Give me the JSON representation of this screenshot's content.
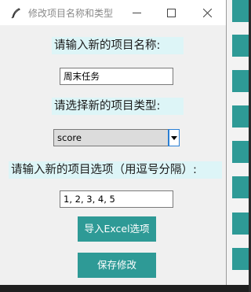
{
  "window": {
    "title": "修改项目名称和类型"
  },
  "form": {
    "name_label": "请输入新的项目名称:",
    "name_value": "周末任务",
    "type_label": "请选择新的项目类型:",
    "type_value": "score",
    "options_label": "请输入新的项目选项（用逗号分隔）:",
    "options_value": "1, 2, 3, 4, 5"
  },
  "buttons": {
    "import_label": "导入Excel选项",
    "save_label": "保存修改"
  },
  "icons": {
    "app": "feather-icon",
    "minimize": "minimize-icon",
    "maximize": "maximize-icon",
    "close": "close-icon",
    "dropdown": "chevron-down-icon"
  },
  "colors": {
    "accent": "#2e9a96",
    "label_bg": "#ddf5f7",
    "window_bg": "#f0f0f0"
  }
}
